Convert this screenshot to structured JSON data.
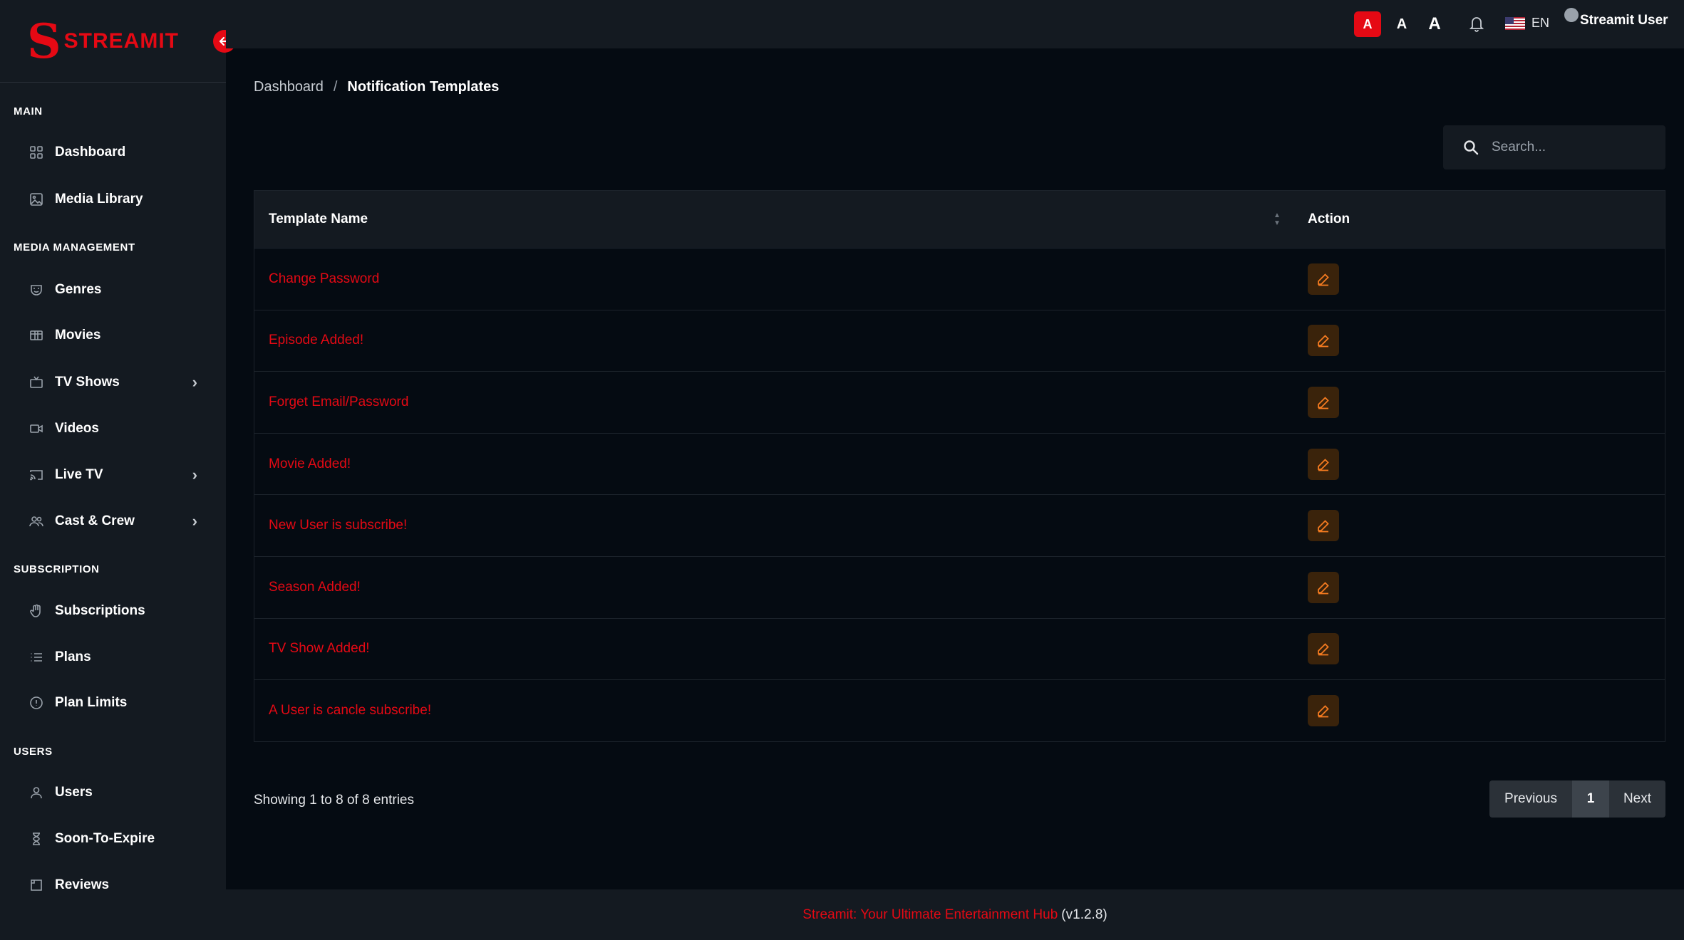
{
  "brand": {
    "letter": "S",
    "name": "STREAMIT"
  },
  "sidebar": {
    "sections": [
      {
        "title": "MAIN"
      },
      {
        "title": "MEDIA MANAGEMENT"
      },
      {
        "title": "SUBSCRIPTION"
      },
      {
        "title": "USERS"
      }
    ],
    "items": [
      {
        "label": "Dashboard",
        "icon": "dashboard-icon"
      },
      {
        "label": "Media Library",
        "icon": "image-icon"
      },
      {
        "label": "Genres",
        "icon": "mask-icon"
      },
      {
        "label": "Movies",
        "icon": "film-icon"
      },
      {
        "label": "TV Shows",
        "icon": "tv-icon"
      },
      {
        "label": "Videos",
        "icon": "video-camera-icon"
      },
      {
        "label": "Live TV",
        "icon": "cast-icon"
      },
      {
        "label": "Cast & Crew",
        "icon": "users-icon"
      },
      {
        "label": "Subscriptions",
        "icon": "hand-icon"
      },
      {
        "label": "Plans",
        "icon": "list-icon"
      },
      {
        "label": "Plan Limits",
        "icon": "info-circle-icon"
      },
      {
        "label": "Users",
        "icon": "user-icon"
      },
      {
        "label": "Soon-To-Expire",
        "icon": "hourglass-icon"
      },
      {
        "label": "Reviews",
        "icon": "review-icon"
      }
    ]
  },
  "topbar": {
    "font_sizes": [
      "A",
      "A",
      "A"
    ],
    "language": "EN",
    "user_name": "Streamit User"
  },
  "breadcrumb": {
    "home": "Dashboard",
    "separator": "/",
    "current": "Notification Templates"
  },
  "search": {
    "placeholder": "Search..."
  },
  "table": {
    "columns": [
      "Template Name",
      "Action"
    ],
    "rows": [
      "Change Password",
      "Episode Added!",
      "Forget Email/Password",
      "Movie Added!",
      "New User is subscribe!",
      "Season Added!",
      "TV Show Added!",
      "A User is cancle subscribe!"
    ]
  },
  "pagination": {
    "summary": "Showing 1 to 8 of 8 entries",
    "previous": "Previous",
    "current_page": "1",
    "next": "Next"
  },
  "footer": {
    "link_text": "Streamit: Your Ultimate Entertainment Hub",
    "version": "(v1.2.8)"
  },
  "colors": {
    "accent": "#e50914",
    "edit_icon": "#f47b20",
    "sidebar_bg": "#141a21",
    "page_bg": "#050b12"
  }
}
